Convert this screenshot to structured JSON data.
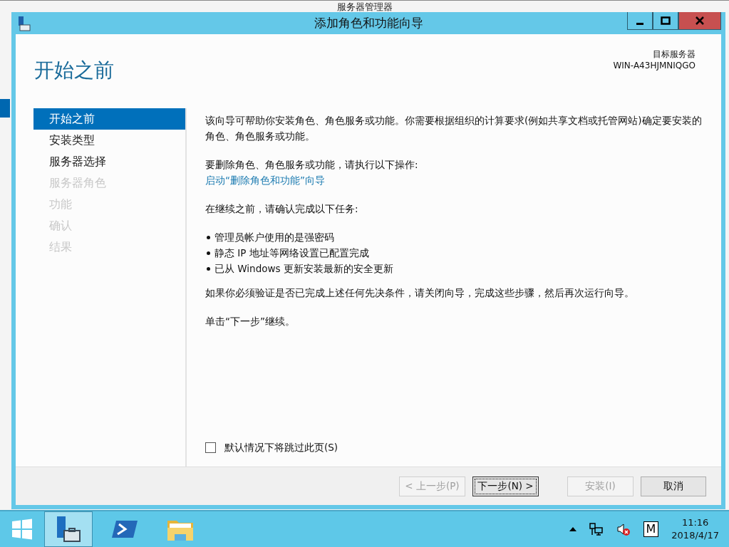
{
  "background_window": {
    "title": "服务器管理器"
  },
  "dialog": {
    "title": "添加角色和功能向导"
  },
  "page_title": "开始之前",
  "target_server": {
    "label": "目标服务器",
    "name": "WIN-A43HJMNIQGO"
  },
  "steps": [
    {
      "label": "开始之前",
      "selected": true,
      "disabled": false
    },
    {
      "label": "安装类型",
      "selected": false,
      "disabled": false
    },
    {
      "label": "服务器选择",
      "selected": false,
      "disabled": false
    },
    {
      "label": "服务器角色",
      "selected": false,
      "disabled": true
    },
    {
      "label": "功能",
      "selected": false,
      "disabled": true
    },
    {
      "label": "确认",
      "selected": false,
      "disabled": true
    },
    {
      "label": "结果",
      "selected": false,
      "disabled": true
    }
  ],
  "intro": "该向导可帮助你安装角色、角色服务或功能。你需要根据组织的计算要求(例如共享文档或托管网站)确定要安装的角色、角色服务或功能。",
  "remove_text": "要删除角色、角色服务或功能，请执行以下操作:",
  "remove_link": "启动“删除角色和功能”向导",
  "before_text": "在继续之前，请确认完成以下任务:",
  "tasks": [
    "管理员帐户使用的是强密码",
    "静态 IP 地址等网络设置已配置完成",
    "已从 Windows 更新安装最新的安全更新"
  ],
  "verify_text": "如果你必须验证是否已完成上述任何先决条件，请关闭向导，完成这些步骤，然后再次运行向导。",
  "next_hint": "单击“下一步”继续。",
  "skip_checkbox": {
    "label": "默认情况下将跳过此页(S)",
    "checked": false
  },
  "buttons": [
    {
      "label": "< 上一步(P)",
      "disabled": true,
      "focused": false
    },
    {
      "label": "下一步(N) >",
      "disabled": false,
      "focused": true
    },
    {
      "label": "安装(I)",
      "disabled": true,
      "focused": false
    },
    {
      "label": "取消",
      "disabled": false,
      "focused": false
    }
  ],
  "taskbar": {
    "apps": [
      {
        "kind": "server-manager",
        "selected": true
      },
      {
        "kind": "powershell",
        "selected": false
      },
      {
        "kind": "explorer",
        "selected": false
      }
    ],
    "tray_letter": "M",
    "time": "11:16",
    "date": "2018/4/17"
  }
}
